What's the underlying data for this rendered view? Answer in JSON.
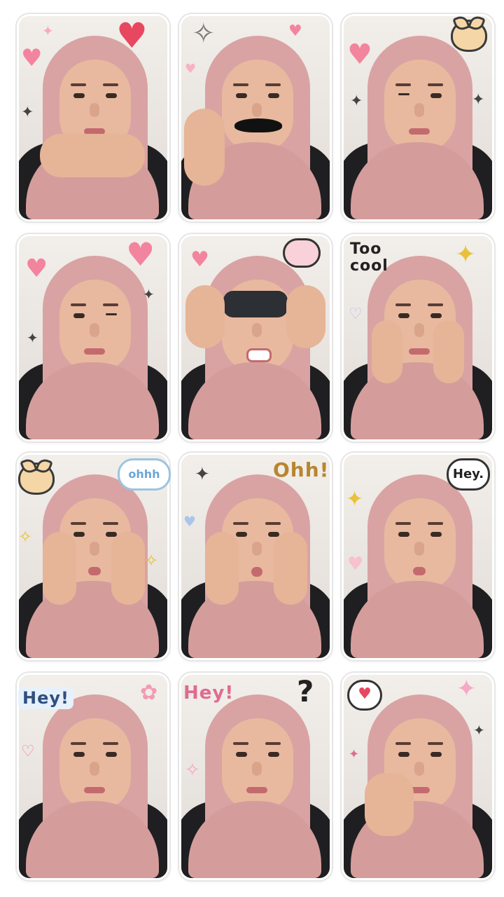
{
  "colors": {
    "hijab": "#d9a3a3",
    "shirt": "#1f1f22",
    "heart": "#f2849e",
    "heart_red": "#e8485f",
    "sparkle_gold": "#e8c23c",
    "border": "#ffffff"
  },
  "stickers": [
    {
      "icons": [
        "heart-icon",
        "heart-icon",
        "sparkle-icon"
      ],
      "texts": []
    },
    {
      "icons": [
        "sparkle-icon",
        "heart-icon",
        "mustache-icon"
      ],
      "texts": []
    },
    {
      "icons": [
        "heart-icon",
        "dog-face-icon",
        "sparkle-icon"
      ],
      "texts": []
    },
    {
      "icons": [
        "heart-icon",
        "heart-icon",
        "sparkle-icon"
      ],
      "texts": []
    },
    {
      "icons": [
        "heart-icon",
        "speech-bubble-icon",
        "binoculars-icon"
      ],
      "texts": []
    },
    {
      "icons": [
        "sparkle-icon",
        "heart-icon"
      ],
      "texts": [
        "Too",
        "cool"
      ]
    },
    {
      "icons": [
        "cat-face-icon",
        "sparkle-icon"
      ],
      "texts": [
        "ohhh"
      ]
    },
    {
      "icons": [
        "heart-icon",
        "sparkle-icon"
      ],
      "texts": [
        "Ohh!"
      ]
    },
    {
      "icons": [
        "sparkle-icon",
        "heart-icon"
      ],
      "texts": [
        "Hey."
      ]
    },
    {
      "icons": [
        "heart-icon",
        "flower-icon"
      ],
      "texts": [
        "Hey!"
      ]
    },
    {
      "icons": [
        "question-icon",
        "sparkle-icon"
      ],
      "texts": [
        "Hey!"
      ]
    },
    {
      "icons": [
        "heart-bubble-icon",
        "sparkle-icon"
      ],
      "texts": []
    }
  ],
  "labels": {
    "too": "Too",
    "cool": "cool",
    "ohhh": "ohhh",
    "ohh": "Ohh!",
    "hey_dot": "Hey.",
    "hey_blue": "Hey!",
    "hey_pink": "Hey!",
    "question": "?"
  }
}
